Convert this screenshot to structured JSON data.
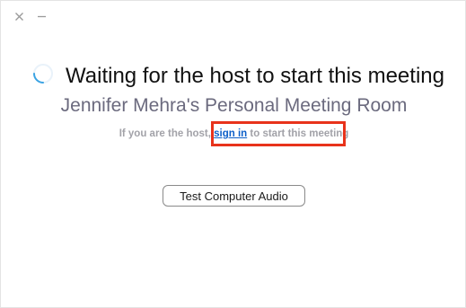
{
  "window": {
    "controls": {
      "close_icon": "close-icon",
      "minimize_icon": "minimize-icon"
    }
  },
  "main": {
    "spinner_icon": "loading-spinner-icon",
    "title": "Waiting for the host to start this meeting",
    "room_name": "Jennifer Mehra's Personal Meeting Room",
    "host_prompt": {
      "prefix": "If you are the host,",
      "link": "sign in",
      "suffix": "to start this meeting"
    },
    "audio_button_label": "Test Computer Audio"
  },
  "colors": {
    "title": "#111111",
    "room_name": "#6b6a7e",
    "prompt_text": "#a2a2a8",
    "link": "#0e60c9",
    "highlight": "#e8331b",
    "spinner": "#3aa3e3"
  }
}
